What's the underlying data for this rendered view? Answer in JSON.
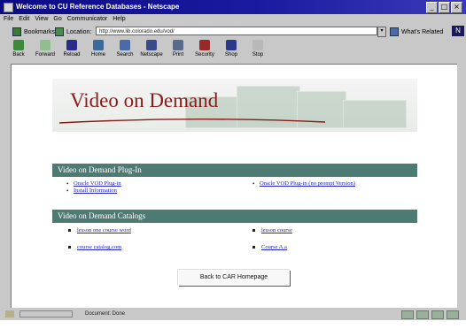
{
  "window": {
    "title": "Welcome to CU Reference Databases - Netscape",
    "controls": [
      "_",
      "□",
      "×"
    ]
  },
  "menubar": {
    "items": [
      "File",
      "Edit",
      "View",
      "Go",
      "Communicator",
      "Help"
    ]
  },
  "locationbar": {
    "bookmarks_label": "Bookmarks",
    "location_label": "Location:",
    "url": "http://www.lib.colorado.edu/vod/",
    "related_label": "What's Related"
  },
  "toolbar": {
    "buttons": [
      {
        "label": "Back",
        "icon": "back-arrow-icon",
        "color": "#3b8a3b"
      },
      {
        "label": "Forward",
        "icon": "forward-arrow-icon",
        "color": "#8fbf8f"
      },
      {
        "label": "Reload",
        "icon": "reload-icon",
        "color": "#2a2a8a"
      },
      {
        "label": "Home",
        "icon": "home-icon",
        "color": "#3a6a9a"
      },
      {
        "label": "Search",
        "icon": "search-icon",
        "color": "#4a6aa8"
      },
      {
        "label": "Netscape",
        "icon": "netscape-icon",
        "color": "#3a4a8a"
      },
      {
        "label": "Print",
        "icon": "print-icon",
        "color": "#5a6a8a"
      },
      {
        "label": "Security",
        "icon": "security-icon",
        "color": "#9a2a2a"
      },
      {
        "label": "Shop",
        "icon": "shop-icon",
        "color": "#2a3a8a"
      },
      {
        "label": "Stop",
        "icon": "stop-icon",
        "color": "#b8b8b8"
      }
    ]
  },
  "page": {
    "banner_title": "Video on Demand",
    "plugin_section": {
      "heading": "Video on Demand Plug-In",
      "left_links": [
        "Oracle VOD Plug-in",
        "Install Information"
      ],
      "right_links": [
        "Oracle VOD Plug-in (no prompt Version)"
      ]
    },
    "catalog_section": {
      "heading": "Video on Demand Catalogs",
      "left_items": [
        "lesson one course word",
        "course catalog.com"
      ],
      "right_items": [
        "lesson course",
        "Course A.a"
      ]
    },
    "back_button": "Back to CAR Homepage"
  },
  "statusbar": {
    "text": "Document: Done"
  },
  "colors": {
    "section_bar": "#4e7a74",
    "banner_title": "#8a1b1b",
    "link": "#2222cc"
  }
}
